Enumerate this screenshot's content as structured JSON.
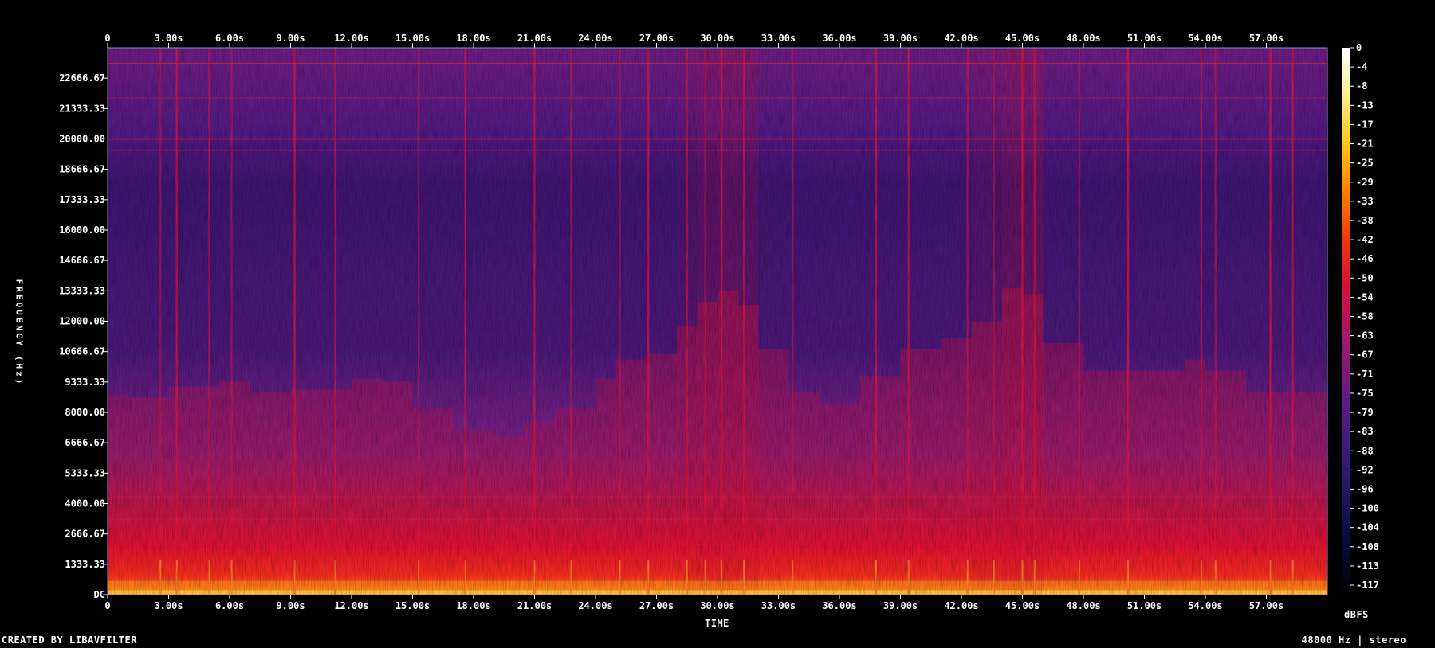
{
  "chart_data": {
    "type": "heatmap",
    "title": "",
    "xlabel": "TIME",
    "ylabel": "FREQUENCY (Hz)",
    "x_ticks": [
      "0",
      "3.00s",
      "6.00s",
      "9.00s",
      "12.00s",
      "15.00s",
      "18.00s",
      "21.00s",
      "24.00s",
      "27.00s",
      "30.00s",
      "33.00s",
      "36.00s",
      "39.00s",
      "42.00s",
      "45.00s",
      "48.00s",
      "51.00s",
      "54.00s",
      "57.00s"
    ],
    "xlim": [
      0,
      60
    ],
    "y_ticks": [
      "DC",
      "1333.33",
      "2666.67",
      "4000.00",
      "5333.33",
      "6666.67",
      "8000.00",
      "9333.33",
      "10666.67",
      "12000.00",
      "13333.33",
      "14666.67",
      "16000.00",
      "17333.33",
      "18666.67",
      "20000.00",
      "21333.33",
      "22666.67"
    ],
    "ylim": [
      0,
      24000
    ],
    "colorbar": {
      "ticks": [
        "0",
        "-4",
        "-8",
        "-13",
        "-17",
        "-21",
        "-25",
        "-29",
        "-33",
        "-38",
        "-42",
        "-46",
        "-50",
        "-54",
        "-58",
        "-63",
        "-67",
        "-71",
        "-75",
        "-79",
        "-83",
        "-88",
        "-92",
        "-96",
        "-100",
        "-104",
        "-108",
        "-113",
        "-117"
      ],
      "unit": "dBFS",
      "range": [
        -120,
        0
      ],
      "colormap": [
        "#000000",
        "#0a0a40",
        "#2a1a6e",
        "#5a1a8a",
        "#9a1a70",
        "#d0103a",
        "#f03010",
        "#ff7a00",
        "#ffc820",
        "#fff4a0",
        "#ffffff"
      ]
    },
    "energy_profile": [
      {
        "t": 0.0,
        "level": 0.35
      },
      {
        "t": 1.0,
        "level": 0.38
      },
      {
        "t": 3.0,
        "level": 0.34
      },
      {
        "t": 5.5,
        "level": 0.42
      },
      {
        "t": 7.0,
        "level": 0.36
      },
      {
        "t": 9.0,
        "level": 0.38
      },
      {
        "t": 12.0,
        "level": 0.37
      },
      {
        "t": 13.5,
        "level": 0.42
      },
      {
        "t": 15.0,
        "level": 0.36
      },
      {
        "t": 17.0,
        "level": 0.32
      },
      {
        "t": 19.0,
        "level": 0.28
      },
      {
        "t": 20.5,
        "level": 0.3
      },
      {
        "t": 22.0,
        "level": 0.33
      },
      {
        "t": 24.0,
        "level": 0.35
      },
      {
        "t": 25.0,
        "level": 0.44
      },
      {
        "t": 26.5,
        "level": 0.42
      },
      {
        "t": 28.0,
        "level": 0.46
      },
      {
        "t": 29.0,
        "level": 0.52
      },
      {
        "t": 30.0,
        "level": 0.55
      },
      {
        "t": 31.0,
        "level": 0.56
      },
      {
        "t": 32.0,
        "level": 0.5
      },
      {
        "t": 33.5,
        "level": 0.4
      },
      {
        "t": 35.0,
        "level": 0.34
      },
      {
        "t": 37.0,
        "level": 0.36
      },
      {
        "t": 39.0,
        "level": 0.44
      },
      {
        "t": 41.0,
        "level": 0.46
      },
      {
        "t": 42.5,
        "level": 0.48
      },
      {
        "t": 44.0,
        "level": 0.52
      },
      {
        "t": 45.0,
        "level": 0.6
      },
      {
        "t": 46.0,
        "level": 0.5
      },
      {
        "t": 48.0,
        "level": 0.42
      },
      {
        "t": 50.0,
        "level": 0.4
      },
      {
        "t": 53.0,
        "level": 0.42
      },
      {
        "t": 54.0,
        "level": 0.44
      },
      {
        "t": 56.0,
        "level": 0.38
      },
      {
        "t": 58.0,
        "level": 0.36
      },
      {
        "t": 60.0,
        "level": 0.38
      }
    ],
    "bright_streaks_t": [
      2.6,
      3.4,
      5.0,
      6.1,
      9.2,
      11.2,
      15.3,
      17.6,
      21.0,
      22.8,
      25.2,
      26.6,
      28.5,
      29.4,
      30.2,
      31.3,
      33.7,
      37.8,
      39.4,
      42.3,
      43.6,
      45.0,
      45.6,
      47.8,
      50.2,
      53.8,
      54.5,
      57.2,
      58.3
    ]
  },
  "footer": {
    "credit": "CREATED BY LIBAVFILTER",
    "info": "48000 Hz | stereo"
  }
}
